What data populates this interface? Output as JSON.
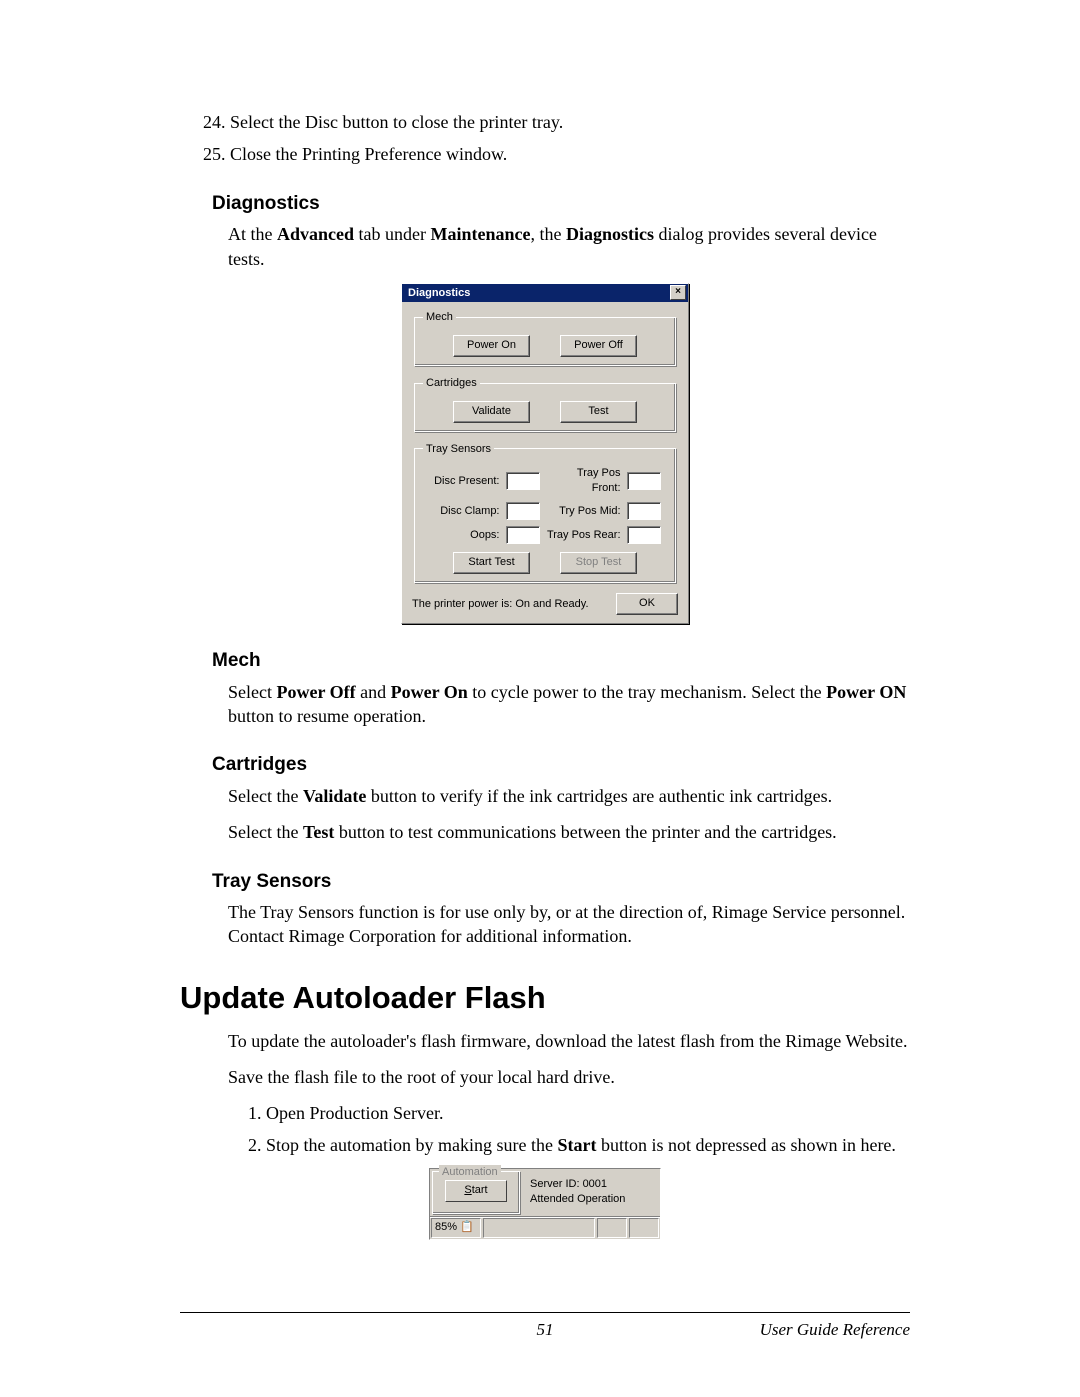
{
  "steps_start": 24,
  "steps": [
    "Select the Disc button to close the printer tray.",
    "Close the Printing Preference window."
  ],
  "diagnostics": {
    "heading": "Diagnostics",
    "intro_prefix": "At the ",
    "intro_b1": "Advanced",
    "intro_mid1": " tab under ",
    "intro_b2": "Maintenance",
    "intro_mid2": ", the ",
    "intro_b3": "Diagnostics",
    "intro_suffix": " dialog provides several device tests."
  },
  "dialog": {
    "title": "Diagnostics",
    "close": "×",
    "mech": {
      "legend": "Mech",
      "power_on": "Power On",
      "power_off": "Power Off"
    },
    "cart": {
      "legend": "Cartridges",
      "validate": "Validate",
      "test": "Test"
    },
    "tray": {
      "legend": "Tray Sensors",
      "disc_present": "Disc Present:",
      "disc_clamp": "Disc Clamp:",
      "oops": "Oops:",
      "pos_front": "Tray Pos Front:",
      "pos_mid": "Try Pos Mid:",
      "pos_rear": "Tray Pos Rear:",
      "start": "Start Test",
      "stop": "Stop Test"
    },
    "status": "The printer power is: On and Ready.",
    "ok": "OK"
  },
  "mech": {
    "heading": "Mech",
    "p_prefix": "Select ",
    "b1": "Power Off",
    "mid1": " and ",
    "b2": "Power On",
    "mid2": " to cycle power to the tray mechanism. Select the ",
    "b3": "Power ON",
    "suffix": " button to resume operation."
  },
  "cart": {
    "heading": "Cartridges",
    "p1a": "Select the ",
    "p1b": "Validate",
    "p1c": " button to verify if the ink cartridges are authentic ink cartridges.",
    "p2a": "Select the ",
    "p2b": "Test",
    "p2c": " button to test communications between the printer and the cartridges."
  },
  "trays": {
    "heading": "Tray Sensors",
    "p": "The Tray Sensors function is for use only by, or at the direction of, Rimage Service personnel. Contact Rimage Corporation for additional information."
  },
  "update": {
    "heading": "Update Autoloader Flash",
    "p1": "To update the autoloader's flash firmware, download the latest flash from the Rimage Website.",
    "p2": "Save the flash file to the root of your local hard drive.",
    "step1": "Open Production Server.",
    "step2a": "Stop the automation by making sure the ",
    "step2b": "Start",
    "step2c": " button is not depressed as shown in here."
  },
  "autopanel": {
    "legend": "Automation",
    "start": "Start",
    "start_underline": "S",
    "server": "Server ID: 0001",
    "mode": "Attended Operation",
    "pct": "85%",
    "icon": "📋"
  },
  "footer": {
    "page": "51",
    "ref": "User Guide Reference"
  }
}
